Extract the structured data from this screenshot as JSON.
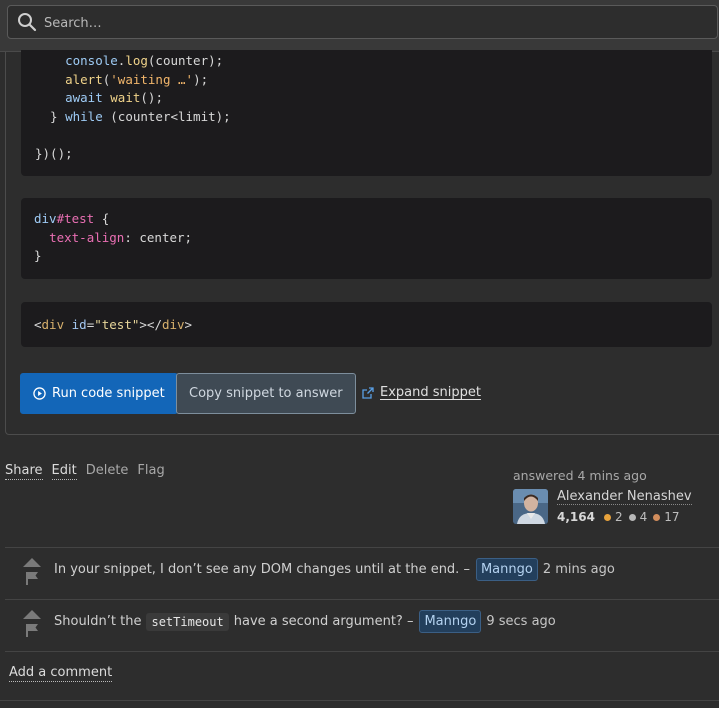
{
  "search": {
    "placeholder": "Search…"
  },
  "snippet": {
    "js_lines": [
      "    console.log(counter);",
      "    alert('waiting …');",
      "    await wait();",
      "  } while (counter<limit);",
      "",
      "})();"
    ],
    "css_lines": [
      "div#test {",
      "  text-align: center;",
      "}"
    ],
    "html_line": "<div id=\"test\"></div>",
    "run_label": "Run code snippet",
    "copy_label": "Copy snippet to answer",
    "expand_label": "Expand snippet"
  },
  "post_menu": {
    "share": "Share",
    "edit": "Edit",
    "delete": "Delete",
    "flag": "Flag"
  },
  "user_card": {
    "answered_prefix": "answered",
    "answered_time": "4 mins ago",
    "name": "Alexander Nenashev",
    "reputation": "4,164",
    "gold": "2",
    "silver": "4",
    "bronze": "17"
  },
  "comments": [
    {
      "text": "In your snippet, I don’t see any DOM changes until at the end. –",
      "user": "Manngo",
      "time": "2 mins ago"
    },
    {
      "text_before": "Shouldn’t the",
      "code": "setTimeout",
      "text_after": "have a second argument? –",
      "user": "Manngo",
      "time": "9 secs ago"
    }
  ],
  "add_comment": "Add a comment",
  "colors": {
    "accent": "#1366b8",
    "gold": "#e7a23c",
    "silver": "#b7b7b7",
    "bronze": "#d28d5c"
  }
}
